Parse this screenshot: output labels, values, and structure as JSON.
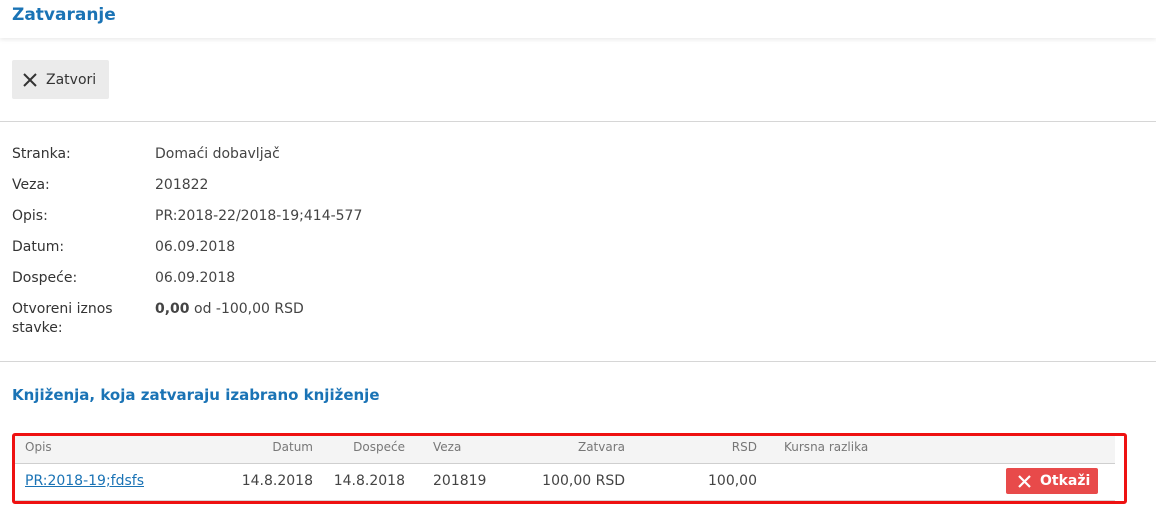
{
  "header": {
    "title": "Zatvaranje"
  },
  "toolbar": {
    "close_label": "Zatvori"
  },
  "details": {
    "stranka_label": "Stranka:",
    "stranka_value": "Domaći dobavljač",
    "veza_label": "Veza:",
    "veza_value": "201822",
    "opis_label": "Opis:",
    "opis_value": "PR:2018-22/2018-19;414-577",
    "datum_label": "Datum:",
    "datum_value": "06.09.2018",
    "dospece_label": "Dospeće:",
    "dospece_value": "06.09.2018",
    "otvoreni_label_line1": "Otvoreni iznos",
    "otvoreni_label_line2": "stavke:",
    "otvoreni_bold": "0,00",
    "otvoreni_rest": " od -100,00 RSD"
  },
  "section": {
    "title": "Knjiženja, koja zatvaraju izabrano knjiženje"
  },
  "table": {
    "headers": {
      "opis": "Opis",
      "datum": "Datum",
      "dospece": "Dospeće",
      "veza": "Veza",
      "zatvara": "Zatvara",
      "rsd": "RSD",
      "kursna": "Kursna razlika"
    },
    "rows": [
      {
        "opis": "PR:2018-19;fdsfs",
        "datum": "14.8.2018",
        "dospece": "14.8.2018",
        "veza": "201819",
        "zatvara": "100,00 RSD",
        "rsd": "100,00",
        "kursna": "",
        "cancel_label": "Otkaži"
      }
    ]
  },
  "colors": {
    "accent": "#1a73b5",
    "danger": "#e84a4a",
    "highlight": "#ee1111"
  }
}
